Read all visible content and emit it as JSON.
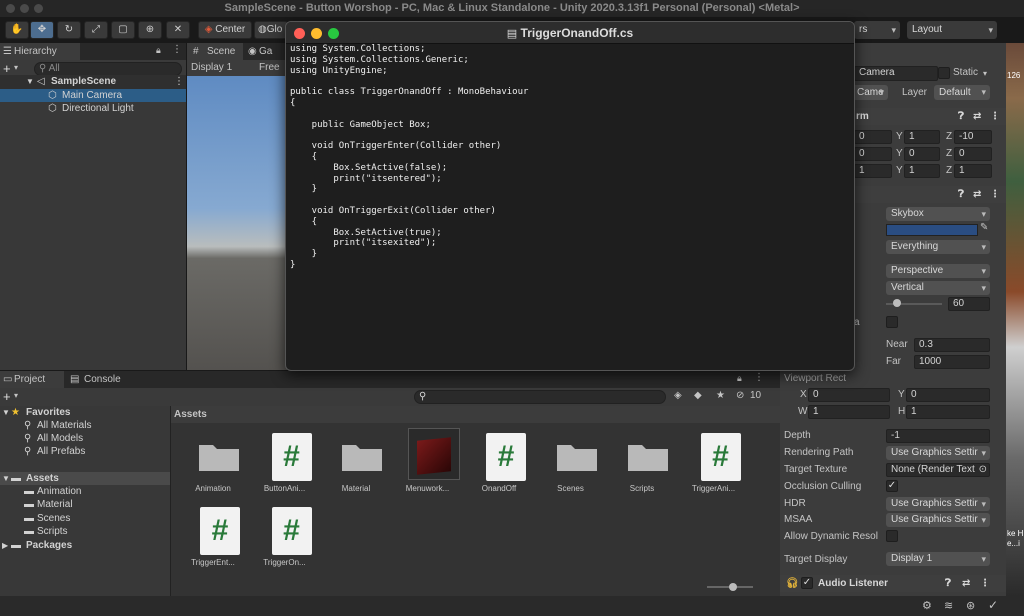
{
  "window_title": "SampleScene - Button Worshop - PC, Mac & Linux Standalone - Unity 2020.3.13f1 Personal (Personal) <Metal>",
  "toolbar": {
    "tools": [
      "hand-tool",
      "move-tool",
      "rotate-tool",
      "scale-tool",
      "rect-tool",
      "transform-tool",
      "custom-tool"
    ],
    "pivot_label": "Center",
    "space_label": "Glo",
    "layers_label": "rs",
    "layout_label": "Layout"
  },
  "hierarchy": {
    "tab_label": "Hierarchy",
    "search_placeholder": "All",
    "scene_name": "SampleScene",
    "items": [
      "Main Camera",
      "Directional Light"
    ]
  },
  "scene": {
    "tab_scene": "Scene",
    "tab_game": "Ga",
    "display_label": "Display 1",
    "free_label": "Free"
  },
  "code_window": {
    "title": "TriggerOnandOff.cs",
    "lines": [
      "using System.Collections;",
      "using System.Collections.Generic;",
      "using UnityEngine;",
      "",
      "public class TriggerOnandOff : MonoBehaviour",
      "{",
      "",
      "    public GameObject Box;",
      "",
      "    void OnTriggerEnter(Collider other)",
      "    {",
      "        Box.SetActive(false);",
      "        print(\"itsentered\");",
      "    }",
      "",
      "    void OnTriggerExit(Collider other)",
      "    {",
      "        Box.SetActive(true);",
      "        print(\"itsexited\");",
      "    }",
      "}"
    ]
  },
  "inspector": {
    "object_name": "Camera",
    "static_label": "Static",
    "tag_value": "Came",
    "layer_label": "Layer",
    "layer_value": "Default",
    "transform_header": "rm",
    "position": {
      "x": "0",
      "y": "1",
      "z": "-10"
    },
    "rotation": {
      "x": "0",
      "y": "0",
      "z": "0"
    },
    "scale": {
      "x": "1",
      "y": "1",
      "z": "1"
    },
    "clear_flags": "Skybox",
    "culling_mask": "Everything",
    "projection": "Perspective",
    "fov_axis": "Vertical",
    "fov_value": "60",
    "fov_slider_fraction": 0.2,
    "physical_camera_label": "a",
    "clipping": {
      "near_label": "Near",
      "near": "0.3",
      "far_label": "Far",
      "far": "1000"
    },
    "viewport_rect_label": "Viewport Rect",
    "viewport": {
      "x_label": "X",
      "x": "0",
      "y_label": "Y",
      "y": "0",
      "w_label": "W",
      "w": "1",
      "h_label": "H",
      "h": "1"
    },
    "depth_label": "Depth",
    "depth": "-1",
    "rendering_path_label": "Rendering Path",
    "rendering_path": "Use Graphics Settir",
    "target_texture_label": "Target Texture",
    "target_texture": "None (Render Text",
    "occlusion_label": "Occlusion Culling",
    "hdr_label": "HDR",
    "hdr_value": "Use Graphics Settir",
    "msaa_label": "MSAA",
    "msaa_value": "Use Graphics Settir",
    "dynamic_res_label": "Allow Dynamic Resol",
    "target_display_label": "Target Display",
    "target_display": "Display 1",
    "audio_listener": "Audio Listener",
    "background_color": "#2a4d82"
  },
  "project": {
    "tab_project": "Project",
    "tab_console": "Console",
    "hidden_count": "10",
    "favorites_label": "Favorites",
    "favorites": [
      "All Materials",
      "All Models",
      "All Prefabs"
    ],
    "assets_label": "Assets",
    "asset_folders": [
      "Animation",
      "Material",
      "Scenes",
      "Scripts"
    ],
    "packages_label": "Packages",
    "breadcrumb": "Assets",
    "grid_items": [
      {
        "name": "Animation",
        "kind": "folder"
      },
      {
        "name": "ButtonAni...",
        "kind": "script"
      },
      {
        "name": "Material",
        "kind": "folder"
      },
      {
        "name": "Menuwork...",
        "kind": "material"
      },
      {
        "name": "OnandOff",
        "kind": "script"
      },
      {
        "name": "Scenes",
        "kind": "folder"
      },
      {
        "name": "Scripts",
        "kind": "folder"
      },
      {
        "name": "TriggerAni...",
        "kind": "script"
      },
      {
        "name": "TriggerEnt...",
        "kind": "script"
      },
      {
        "name": "TriggerOn...",
        "kind": "script"
      }
    ]
  },
  "side_strip": {
    "top_text": "126",
    "mid_text": "ke H\ne...i"
  },
  "colors": {
    "selection": "#2c5d87",
    "accent_active": "#4d6d8f",
    "script_green": "#2a7a3a"
  }
}
